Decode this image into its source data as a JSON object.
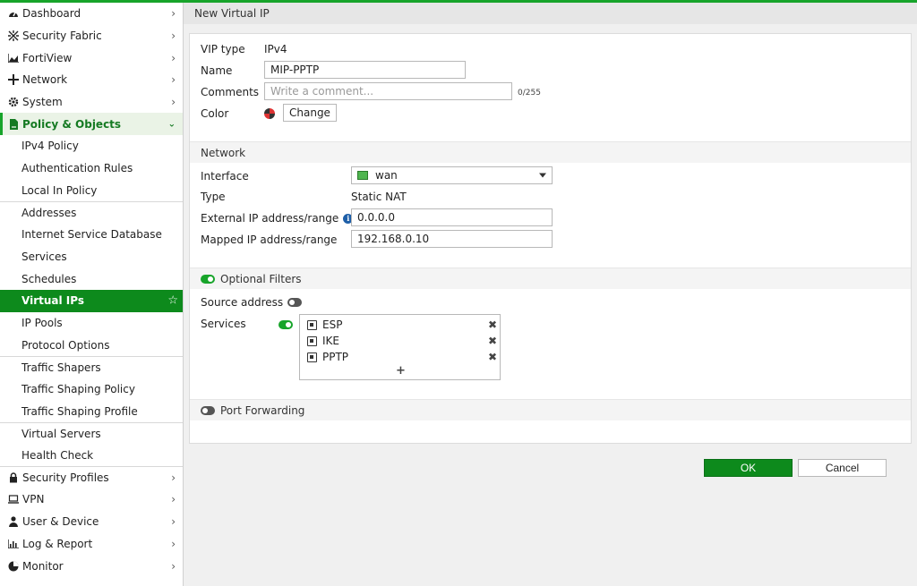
{
  "sidebar": {
    "items": [
      {
        "label": "Dashboard",
        "icon": "dashboard-icon"
      },
      {
        "label": "Security Fabric",
        "icon": "security-fabric-icon"
      },
      {
        "label": "FortiView",
        "icon": "fortiview-icon"
      },
      {
        "label": "Network",
        "icon": "network-icon"
      },
      {
        "label": "System",
        "icon": "gear-icon"
      },
      {
        "label": "Policy & Objects",
        "icon": "policy-icon"
      },
      {
        "label": "IPv4 Policy"
      },
      {
        "label": "Authentication Rules"
      },
      {
        "label": "Local In Policy"
      },
      {
        "label": "Addresses"
      },
      {
        "label": "Internet Service Database"
      },
      {
        "label": "Services"
      },
      {
        "label": "Schedules"
      },
      {
        "label": "Virtual IPs"
      },
      {
        "label": "IP Pools"
      },
      {
        "label": "Protocol Options"
      },
      {
        "label": "Traffic Shapers"
      },
      {
        "label": "Traffic Shaping Policy"
      },
      {
        "label": "Traffic Shaping Profile"
      },
      {
        "label": "Virtual Servers"
      },
      {
        "label": "Health Check"
      },
      {
        "label": "Security Profiles",
        "icon": "lock-icon"
      },
      {
        "label": "VPN",
        "icon": "vpn-icon"
      },
      {
        "label": "User & Device",
        "icon": "user-icon"
      },
      {
        "label": "Log & Report",
        "icon": "log-icon"
      },
      {
        "label": "Monitor",
        "icon": "monitor-icon"
      }
    ]
  },
  "page": {
    "title": "New Virtual IP"
  },
  "form": {
    "vip_type_label": "VIP type",
    "vip_type_value": "IPv4",
    "name_label": "Name",
    "name_value": "MIP-PPTP",
    "comments_label": "Comments",
    "comments_placeholder": "Write a comment...",
    "comments_counter": "0/255",
    "color_label": "Color",
    "change_button": "Change"
  },
  "network": {
    "section_title": "Network",
    "interface_label": "Interface",
    "interface_value": "wan",
    "type_label": "Type",
    "type_value": "Static NAT",
    "external_label": "External IP address/range",
    "external_value": "0.0.0.0",
    "mapped_label": "Mapped IP address/range",
    "mapped_value": "192.168.0.10"
  },
  "filters": {
    "section_title": "Optional Filters",
    "source_label": "Source address",
    "services_label": "Services",
    "services": [
      "ESP",
      "IKE",
      "PPTP"
    ],
    "add_symbol": "+"
  },
  "port_forwarding": {
    "section_title": "Port Forwarding"
  },
  "actions": {
    "ok": "OK",
    "cancel": "Cancel"
  },
  "colors": {
    "accent": "#17a42a",
    "active_nav": "#0d8a1c"
  }
}
